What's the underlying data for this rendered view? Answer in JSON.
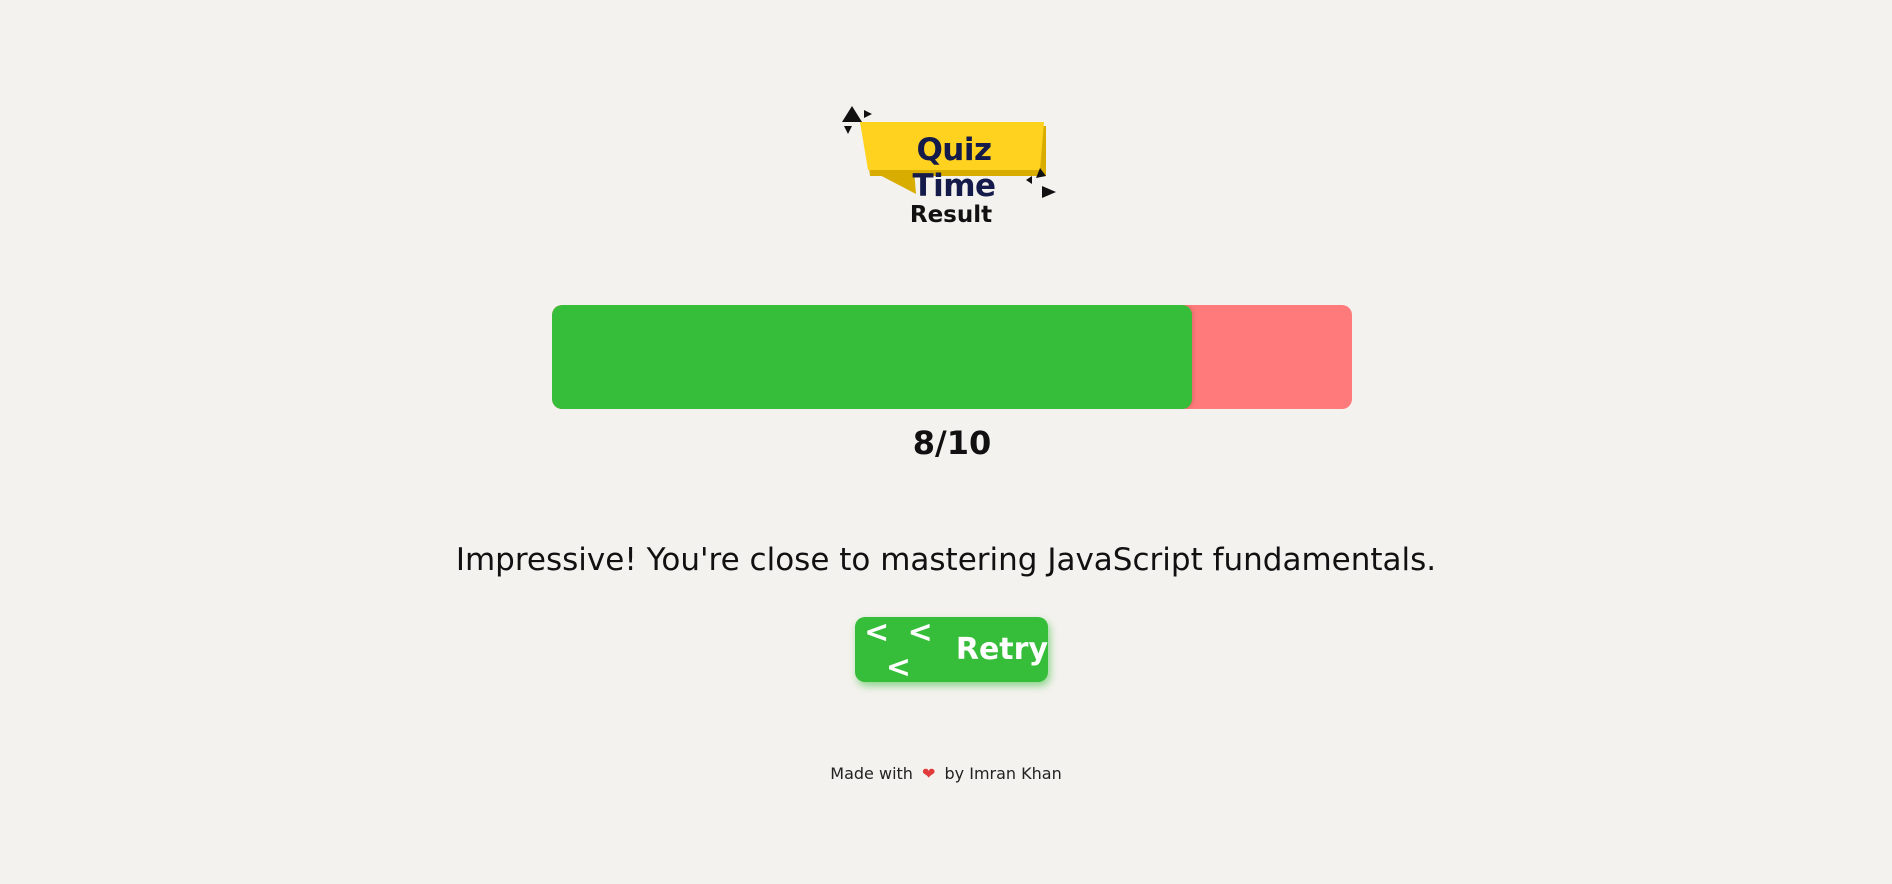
{
  "logo": {
    "text": "Quiz Time",
    "colors": {
      "banner": "#ffd21f",
      "banner_shade": "#d8ad00",
      "text": "#141a4a",
      "triangles": "#111111"
    }
  },
  "header": {
    "subtitle": "Result"
  },
  "progress": {
    "correct": 8,
    "total": 10,
    "fill_fraction": 0.8,
    "colors": {
      "correct": "#36be3a",
      "incorrect": "#ff7b7b"
    }
  },
  "score_label": "8/10",
  "message": "Impressive! You're close to mastering JavaScript fundamentals.",
  "retry_button": {
    "chevrons": "< < <",
    "label": "Retry",
    "color": "#36be3a"
  },
  "footer": {
    "made_with": "Made with",
    "heart_icon": "heart-icon",
    "by": "by Imran Khan"
  }
}
